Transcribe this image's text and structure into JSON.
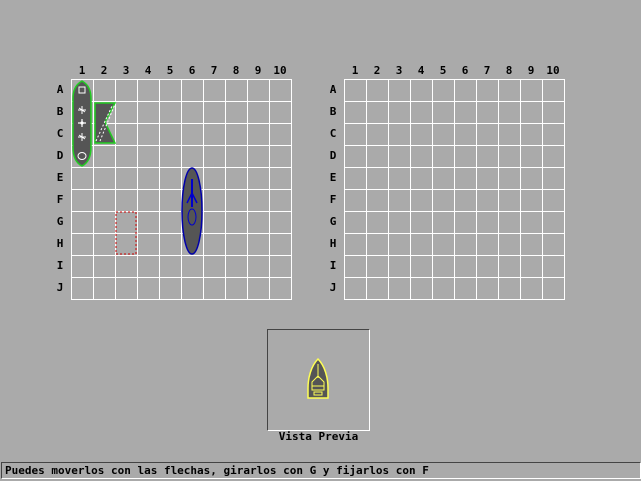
{
  "columns": [
    "1",
    "2",
    "3",
    "4",
    "5",
    "6",
    "7",
    "8",
    "9",
    "10"
  ],
  "rows": [
    "A",
    "B",
    "C",
    "D",
    "E",
    "F",
    "G",
    "H",
    "I",
    "J"
  ],
  "preview_label": "Vista Previa",
  "status_message": "Puedes moverlos con las flechas, girarlos con G y fijarlos con F",
  "colors": {
    "background": "#aaaaaa",
    "grid_lines": "#ffffff",
    "placed_ship_outline": "#22cc22",
    "moving_ship_outline": "#0000aa",
    "preview_ship_outline": "#ffff55",
    "placement_cursor": "#cc0000",
    "ship_hull": "#555555"
  },
  "player_board": {
    "placed_ships": [
      {
        "name": "submarine",
        "cells": [
          "A1",
          "B1",
          "C1",
          "D1"
        ],
        "orientation": "vertical"
      },
      {
        "name": "flag-ship",
        "cells": [
          "B2",
          "C2"
        ],
        "orientation": "vertical"
      }
    ],
    "active_ship": {
      "name": "cruiser",
      "cells": [
        "E6",
        "F6",
        "G6",
        "H6"
      ],
      "orientation": "vertical"
    },
    "placement_cursor": {
      "cells": [
        "G3",
        "H3"
      ]
    }
  },
  "preview_ship": {
    "name": "boat",
    "orientation": "vertical"
  }
}
